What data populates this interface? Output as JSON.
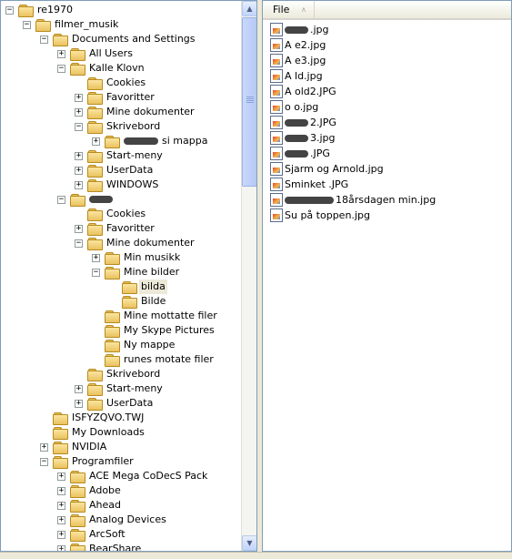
{
  "tree": {
    "rows": [
      {
        "label": "re1970",
        "indent": 0,
        "expander": "−"
      },
      {
        "label": "filmer_musik",
        "indent": 1,
        "expander": "−"
      },
      {
        "label": "Documents and Settings",
        "indent": 2,
        "expander": "−"
      },
      {
        "label": "All Users",
        "indent": 3,
        "expander": "+"
      },
      {
        "label": "Kalle Klovn",
        "indent": 3,
        "expander": "−"
      },
      {
        "label": "Cookies",
        "indent": 4,
        "expander": ""
      },
      {
        "label": "Favoritter",
        "indent": 4,
        "expander": "+"
      },
      {
        "label": "Mine dokumenter",
        "indent": 4,
        "expander": "+"
      },
      {
        "label": "Skrivebord",
        "indent": 4,
        "expander": "−"
      },
      {
        "label": "si mappa",
        "indent": 5,
        "expander": "+",
        "blot": 38
      },
      {
        "label": "Start-meny",
        "indent": 4,
        "expander": "+"
      },
      {
        "label": "UserData",
        "indent": 4,
        "expander": "+"
      },
      {
        "label": "WINDOWS",
        "indent": 4,
        "expander": "+"
      },
      {
        "label": "",
        "indent": 3,
        "expander": "−",
        "blot": 26
      },
      {
        "label": "Cookies",
        "indent": 4,
        "expander": ""
      },
      {
        "label": "Favoritter",
        "indent": 4,
        "expander": "+"
      },
      {
        "label": "Mine dokumenter",
        "indent": 4,
        "expander": "−"
      },
      {
        "label": "Min musikk",
        "indent": 5,
        "expander": "+"
      },
      {
        "label": "Mine bilder",
        "indent": 5,
        "expander": "−"
      },
      {
        "label": "bilda",
        "indent": 6,
        "expander": "",
        "selected": true
      },
      {
        "label": "Bilde",
        "indent": 6,
        "expander": ""
      },
      {
        "label": "Mine mottatte filer",
        "indent": 5,
        "expander": ""
      },
      {
        "label": "My Skype Pictures",
        "indent": 5,
        "expander": ""
      },
      {
        "label": "Ny mappe",
        "indent": 5,
        "expander": ""
      },
      {
        "label": "runes motate filer",
        "indent": 5,
        "expander": ""
      },
      {
        "label": "Skrivebord",
        "indent": 4,
        "expander": ""
      },
      {
        "label": "Start-meny",
        "indent": 4,
        "expander": "+"
      },
      {
        "label": "UserData",
        "indent": 4,
        "expander": "+"
      },
      {
        "label": "ISFYZQVO.TWJ",
        "indent": 2,
        "expander": ""
      },
      {
        "label": "My Downloads",
        "indent": 2,
        "expander": ""
      },
      {
        "label": "NVIDIA",
        "indent": 2,
        "expander": "+"
      },
      {
        "label": "Programfiler",
        "indent": 2,
        "expander": "−"
      },
      {
        "label": "ACE Mega CoDecS Pack",
        "indent": 3,
        "expander": "+"
      },
      {
        "label": "Adobe",
        "indent": 3,
        "expander": "+"
      },
      {
        "label": "Ahead",
        "indent": 3,
        "expander": "+"
      },
      {
        "label": "Analog Devices",
        "indent": 3,
        "expander": "+"
      },
      {
        "label": "ArcSoft",
        "indent": 3,
        "expander": "+"
      },
      {
        "label": "BearShare",
        "indent": 3,
        "expander": "+"
      }
    ],
    "scroll_up": "▲",
    "scroll_down": "▼"
  },
  "list": {
    "column_header": "File",
    "sort_glyph": "∧",
    "files": [
      {
        "name": ".jpg",
        "blot_before": 26
      },
      {
        "name": "A  e2.jpg",
        "blot_before": 0
      },
      {
        "name": "A  e3.jpg",
        "blot_before": 0
      },
      {
        "name": "A   ld.jpg",
        "blot_before": 0
      },
      {
        "name": "A   old2.JPG",
        "blot_before": 0
      },
      {
        "name": "o  o.jpg",
        "blot_before": 0
      },
      {
        "name": "2.JPG",
        "blot_before": 26
      },
      {
        "name": "3.jpg",
        "blot_before": 26
      },
      {
        "name": ".JPG",
        "blot_before": 26
      },
      {
        "name": "Sjarm og Arnold.jpg",
        "blot_before": 0
      },
      {
        "name": "Sminket .JPG",
        "blot_before": 0
      },
      {
        "name": "18årsdagen min.jpg",
        "blot_before": 54
      },
      {
        "name": "Su   på toppen.jpg",
        "blot_before": 0
      }
    ]
  }
}
